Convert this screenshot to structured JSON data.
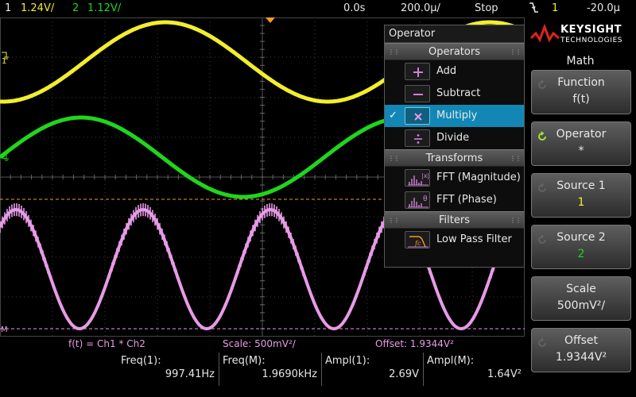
{
  "status_bar": {
    "ch1_number": "1",
    "ch1_scale": "1.24V/",
    "ch2_number": "2",
    "ch2_scale": "1.12V/",
    "time_position": "0.0s",
    "time_scale": "200.0µ/",
    "run_state": "Stop",
    "trigger_slope_icon": "falling-edge-icon",
    "trigger_source": "1",
    "trigger_level": "-20.0µ"
  },
  "waveforms": {
    "ch1_color": "#f2ee2c",
    "ch2_color": "#1fd61c",
    "math_color": "#e79be6",
    "grid_color": "#3c3c3c",
    "ch1_marker": "1",
    "ch2_marker": "2",
    "math_marker": "M"
  },
  "operator_menu": {
    "title": "Operator",
    "sections": {
      "operators": "Operators",
      "transforms": "Transforms",
      "filters": "Filters"
    },
    "operators": [
      {
        "label": "Add",
        "icon": "plus-icon",
        "selected": false
      },
      {
        "label": "Subtract",
        "icon": "minus-icon",
        "selected": false
      },
      {
        "label": "Multiply",
        "icon": "multiply-icon",
        "selected": true
      },
      {
        "label": "Divide",
        "icon": "divide-icon",
        "selected": false
      }
    ],
    "transforms": [
      {
        "label": "FFT (Magnitude)",
        "icon": "fft-magnitude-icon",
        "icon_text": "|x|"
      },
      {
        "label": "FFT (Phase)",
        "icon": "fft-phase-icon",
        "icon_text": "θ"
      }
    ],
    "filters": [
      {
        "label": "Low Pass Filter",
        "icon": "low-pass-filter-icon",
        "icon_text": "fc"
      }
    ],
    "selected_check": "✓"
  },
  "right_panel": {
    "brand": "KEYSIGHT",
    "brand_sub": "TECHNOLOGIES",
    "menu_title": "Math",
    "softkeys": [
      {
        "label": "Function",
        "value": "f(t)",
        "value_color": "#e8e8e8",
        "active": false
      },
      {
        "label": "Operator",
        "value": "*",
        "value_color": "#e8e8e8",
        "active": true
      },
      {
        "label": "Source 1",
        "value": "1",
        "value_color": "#f2ee2c",
        "active": false
      },
      {
        "label": "Source 2",
        "value": "2",
        "value_color": "#1fd61c",
        "active": false
      },
      {
        "label": "Scale",
        "value": "500mV²/",
        "value_color": "#e8e8e8",
        "active": false
      },
      {
        "label": "Offset",
        "value": "1.9344V²",
        "value_color": "#e8e8e8",
        "active": false
      }
    ]
  },
  "math_info": {
    "function": "f(t) = Ch1 * Ch2",
    "scale": "Scale: 500mV²/",
    "offset": "Offset: 1.9344V²"
  },
  "measurements": [
    {
      "label": "Freq(1):",
      "value": "997.41Hz"
    },
    {
      "label": "Freq(M):",
      "value": "1.9690kHz"
    },
    {
      "label": "Ampl(1):",
      "value": "2.69V"
    },
    {
      "label": "Ampl(M):",
      "value": "1.64V²"
    }
  ]
}
